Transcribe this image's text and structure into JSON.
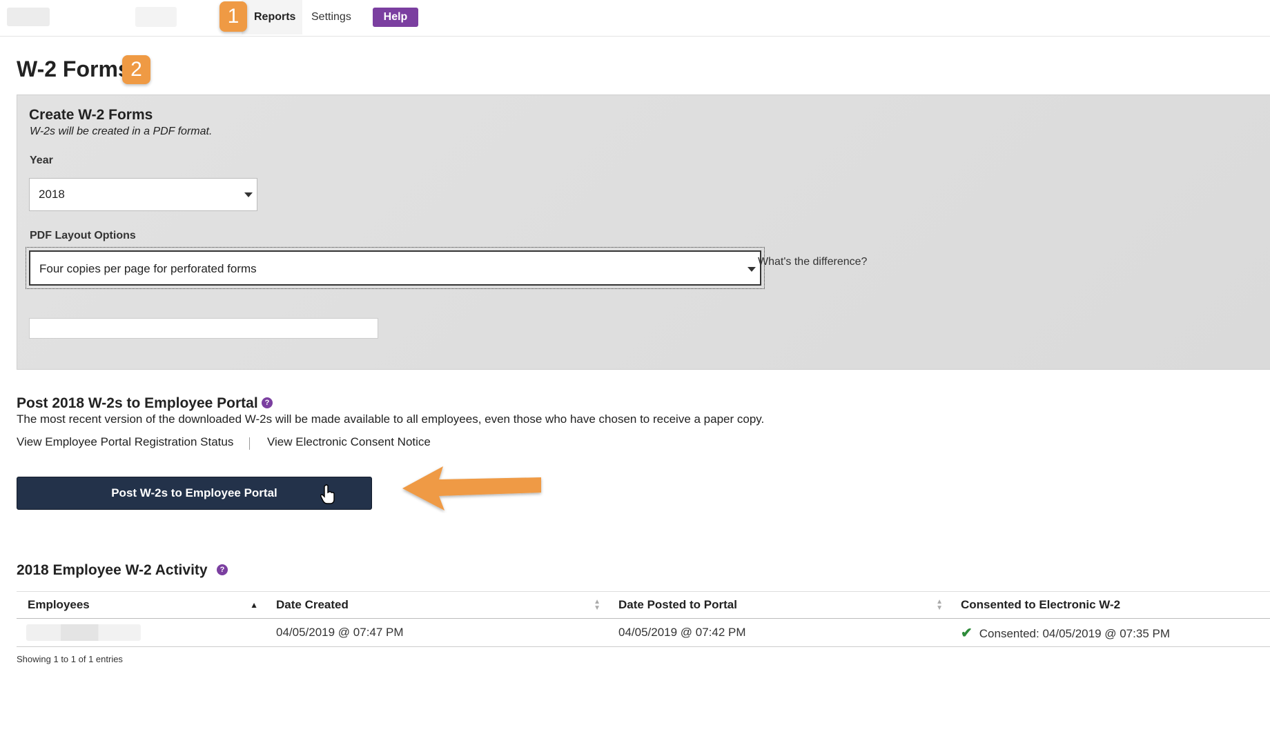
{
  "nav": {
    "callout1": "1",
    "reports": "Reports",
    "settings": "Settings",
    "help": "Help"
  },
  "page": {
    "title": "W-2 Forms",
    "callout2": "2"
  },
  "create": {
    "title": "Create W-2 Forms",
    "subtitle": "W-2s will be created in a PDF format.",
    "year_label": "Year",
    "year_value": "2018",
    "layout_label": "PDF Layout Options",
    "layout_value": "Four copies per page for perforated forms",
    "difference_link": "What's the difference?"
  },
  "post": {
    "title": "Post 2018 W-2s to Employee Portal",
    "help_icon": "?",
    "description": "The most recent version of the downloaded W-2s will be made available to all employees, even those who have chosen to receive a paper copy.",
    "registration_link": "View Employee Portal Registration Status",
    "consent_link": "View Electronic Consent Notice",
    "button": "Post W-2s to Employee Portal"
  },
  "activity": {
    "title": "2018 Employee W-2 Activity",
    "help_icon": "?",
    "columns": [
      "Employees",
      "Date Created",
      "Date Posted to Portal",
      "Consented to Electronic W-2"
    ],
    "rows": [
      {
        "employee": "",
        "date_created": "04/05/2019 @ 07:47 PM",
        "date_posted": "04/05/2019 @ 07:42 PM",
        "consented": "Consented: 04/05/2019 @ 07:35 PM"
      }
    ],
    "info": "Showing 1 to 1 of 1 entries"
  },
  "colors": {
    "callout": "#ef9a44",
    "help_purple": "#7b3fa0",
    "primary_button": "#23324a",
    "check_green": "#2e8b3a"
  },
  "icons": {
    "check": "checkmark-icon",
    "help": "question-circle-icon",
    "cursor": "hand-pointer-icon",
    "annotation": "arrow-left-annotation"
  }
}
